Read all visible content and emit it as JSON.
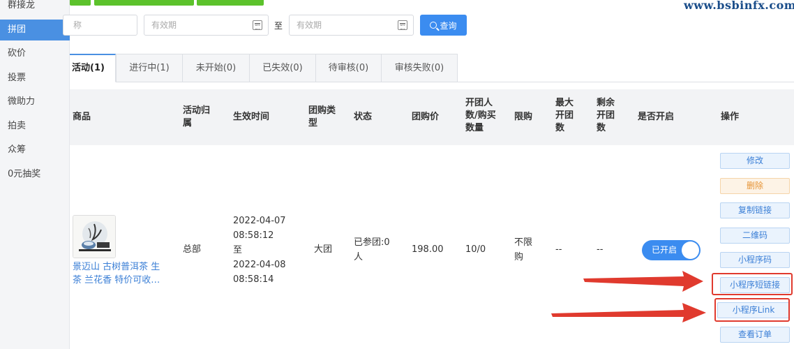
{
  "sidebar": {
    "items": [
      {
        "label": "群接龙"
      },
      {
        "label": "拼团"
      },
      {
        "label": "砍价"
      },
      {
        "label": "投票"
      },
      {
        "label": "微助力"
      },
      {
        "label": "拍卖"
      },
      {
        "label": "众筹"
      },
      {
        "label": "0元抽奖"
      }
    ]
  },
  "filters": {
    "name_placeholder_partial": "称",
    "start_placeholder": "有效期",
    "to_label": "至",
    "end_placeholder": "有效期",
    "query_label": "查询"
  },
  "tabs": [
    {
      "label": "活动(1)"
    },
    {
      "label": "进行中(1)"
    },
    {
      "label": "未开始(0)"
    },
    {
      "label": "已失效(0)"
    },
    {
      "label": "待审核(0)"
    },
    {
      "label": "审核失败(0)"
    }
  ],
  "table": {
    "headers": {
      "product": "商品",
      "belong_1": "活动归",
      "belong_2": "属",
      "effective_time": "生效时间",
      "group_type_1": "团购类",
      "group_type_2": "型",
      "status": "状态",
      "price": "团购价",
      "count_1": "开团人",
      "count_2": "数/购买",
      "count_3": "数量",
      "limit": "限购",
      "max_1": "最大",
      "max_2": "开团",
      "max_3": "数",
      "remain_1": "剩余",
      "remain_2": "开团",
      "remain_3": "数",
      "enabled": "是否开启",
      "operation": "操作"
    },
    "row": {
      "product_name_1": "景迈山 古树普洱茶 生",
      "product_name_2": "茶 兰花香 特价可收…",
      "belong": "总部",
      "start_date": "2022-04-07",
      "start_time": "08:58:12",
      "to": "至",
      "end_date": "2022-04-08",
      "end_time": "08:58:14",
      "group_type": "大团",
      "status_1": "已参团:0",
      "status_2": "人",
      "price": "198.00",
      "count": "10/0",
      "limit_1": "不限",
      "limit_2": "购",
      "max": "--",
      "remain": "--",
      "toggle_label": "已开启"
    }
  },
  "operations": {
    "edit": "修改",
    "delete": "删除",
    "copy_link": "复制链接",
    "qrcode": "二维码",
    "mini_code": "小程序码",
    "mini_short_link": "小程序短链接",
    "mini_link": "小程序Link",
    "view_orders": "查看订单"
  },
  "watermark": "www.bsbinfx.com",
  "colors": {
    "primary": "#3b8cf0",
    "green": "#5cc22c",
    "danger": "#e69437",
    "annotation_red": "#e03a2e"
  }
}
